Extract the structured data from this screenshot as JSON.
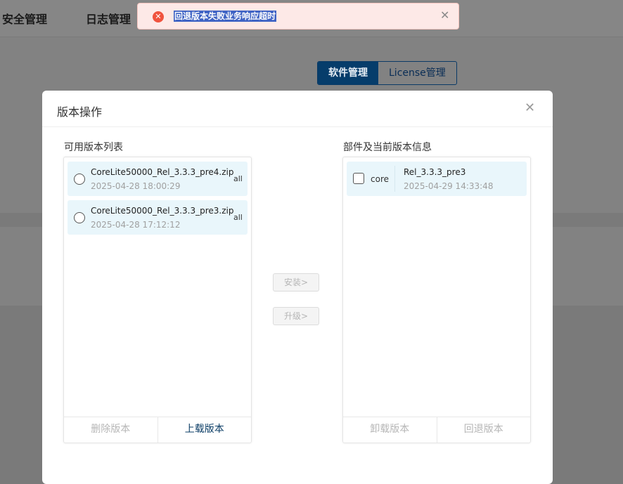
{
  "nav": {
    "items": [
      "安全管理",
      "日志管理"
    ]
  },
  "tabs": {
    "software": "软件管理",
    "license": "License管理"
  },
  "toast": {
    "icon": "error-circle-icon",
    "message": "回退版本失败业务响应超时",
    "close": "✕"
  },
  "modal": {
    "title": "版本操作",
    "close": "✕",
    "left_panel": {
      "label": "可用版本列表",
      "packages": [
        {
          "name": "CoreLite50000_Rel_3.3.3_pre4.zip",
          "date": "2025-04-28 18:00:29",
          "tag": "all"
        },
        {
          "name": "CoreLite50000_Rel_3.3.3_pre3.zip",
          "date": "2025-04-28 17:12:12",
          "tag": "all"
        }
      ],
      "delete_label": "删除版本",
      "upload_label": "上载版本"
    },
    "actions": {
      "install": "安装>",
      "upgrade": "升级>"
    },
    "right_panel": {
      "label": "部件及当前版本信息",
      "components": [
        {
          "name": "core",
          "version": "Rel_3.3.3_pre3",
          "date": "2025-04-29 14:33:48"
        }
      ],
      "uninstall_label": "卸载版本",
      "rollback_label": "回退版本"
    }
  }
}
